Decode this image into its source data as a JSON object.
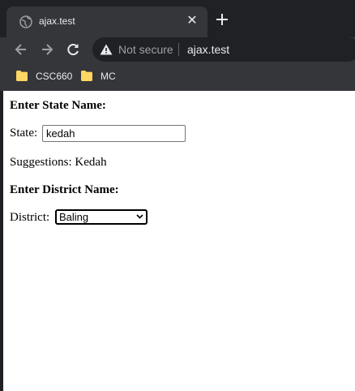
{
  "browser": {
    "tab_title": "ajax.test",
    "tab_close": "✕",
    "security_label": "Not secure",
    "url": "ajax.test",
    "bookmarks": [
      {
        "label": "CSC660"
      },
      {
        "label": "MC"
      }
    ]
  },
  "page": {
    "state_heading": "Enter State Name:",
    "state_label": "State:",
    "state_value": "kedah",
    "suggestions_text": "Suggestions: Kedah",
    "district_heading": "Enter District Name:",
    "district_label": "District:",
    "district_selected": "Baling"
  },
  "colors": {
    "chrome_dark": "#202124",
    "chrome_mid": "#35363a",
    "text_light": "#e8eaed",
    "folder_yellow": "#fdd663"
  }
}
